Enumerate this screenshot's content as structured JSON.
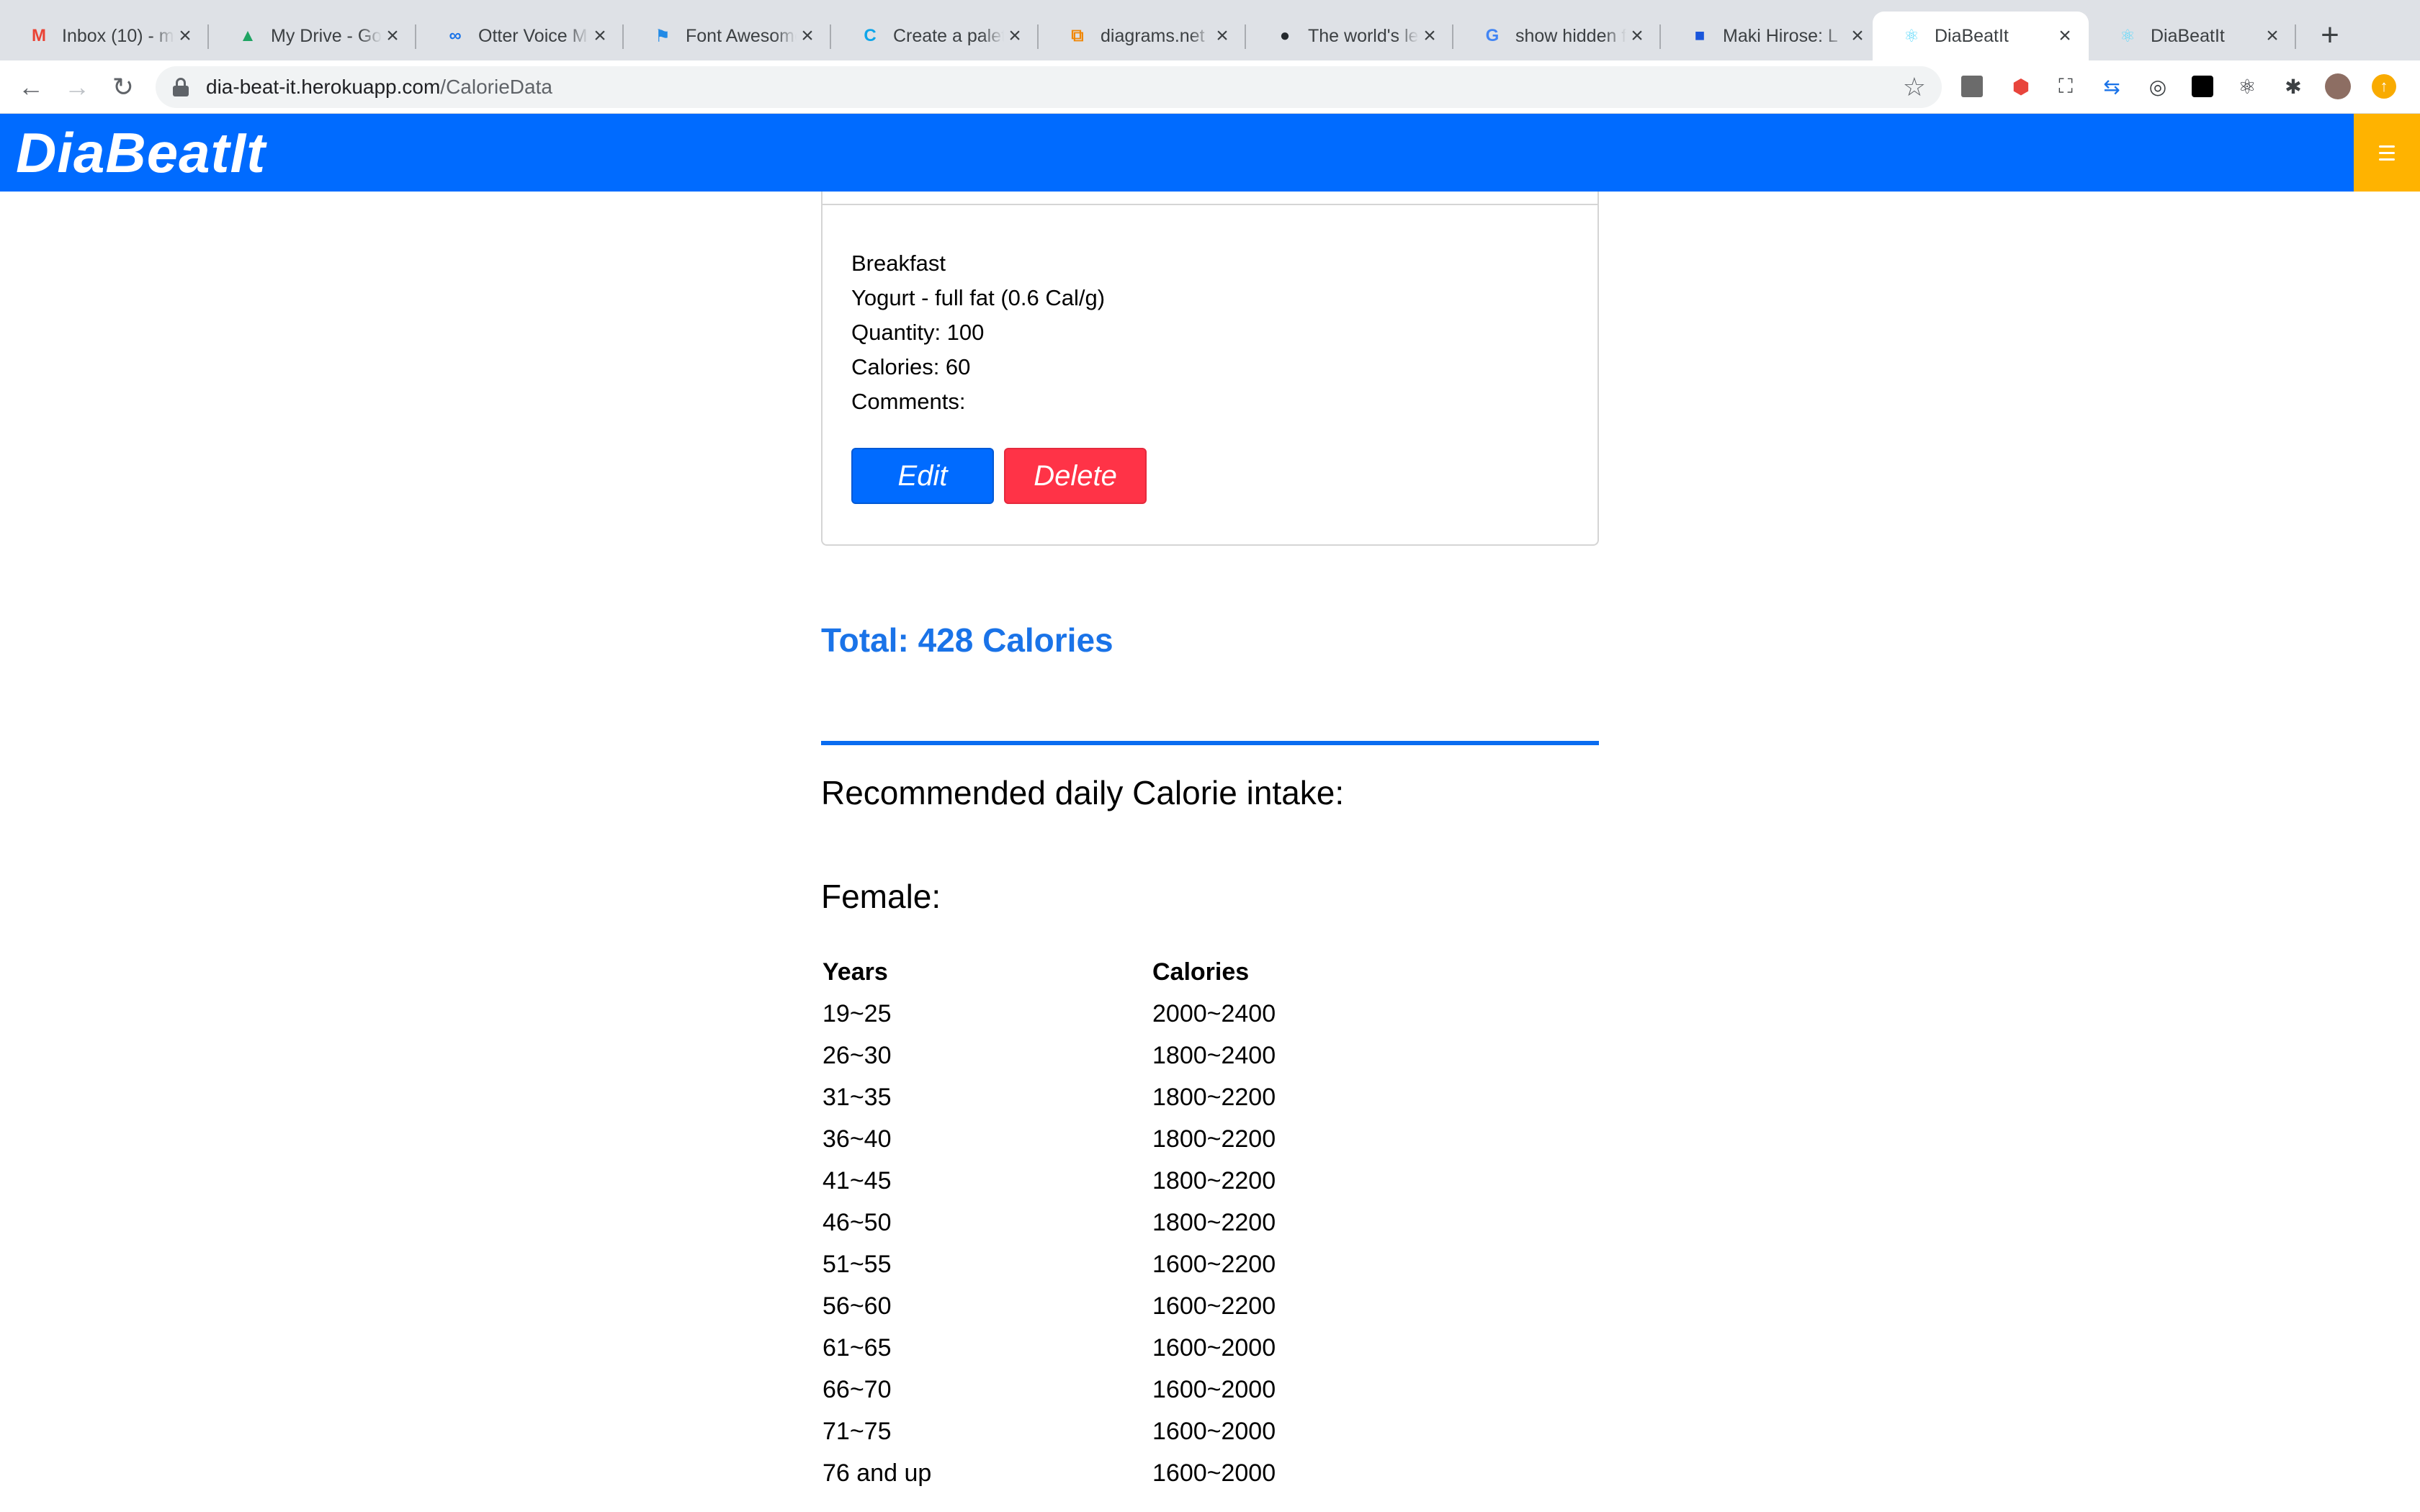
{
  "browser": {
    "tabs": [
      {
        "title": "Inbox (10) - m",
        "icon": "gmail-icon",
        "glyph": "M",
        "color": "#ea4335"
      },
      {
        "title": "My Drive - Go",
        "icon": "drive-icon",
        "glyph": "▲",
        "color": "#1fa463"
      },
      {
        "title": "Otter Voice M",
        "icon": "otter-icon",
        "glyph": "∞",
        "color": "#1a73e8"
      },
      {
        "title": "Font Awesome",
        "icon": "flag-icon",
        "glyph": "⚑",
        "color": "#228ae6"
      },
      {
        "title": "Create a palet",
        "icon": "coolors-icon",
        "glyph": "C",
        "color": "#0ea5e9"
      },
      {
        "title": "diagrams.net",
        "icon": "diagrams-icon",
        "glyph": "⧉",
        "color": "#f08705"
      },
      {
        "title": "The world's le",
        "icon": "github-icon",
        "glyph": "●",
        "color": "#24292e"
      },
      {
        "title": "show hidden f",
        "icon": "google-icon",
        "glyph": "G",
        "color": "#4285f4"
      },
      {
        "title": "Maki Hirose: L",
        "icon": "app-icon",
        "glyph": "■",
        "color": "#1a56db"
      },
      {
        "title": "DiaBeatIt",
        "icon": "react-icon",
        "glyph": "⚛",
        "color": "#61dafb",
        "active": true
      },
      {
        "title": "DiaBeatIt",
        "icon": "react-icon",
        "glyph": "⚛",
        "color": "#61dafb"
      }
    ],
    "url_host": "dia-beat-it.herokuapp.com",
    "url_path": "/CalorieData"
  },
  "app": {
    "brand": "DiaBeatIt",
    "colors": {
      "primary": "#006bff",
      "accent": "#ffb300",
      "danger": "#ff3347"
    }
  },
  "entry": {
    "meal": "Breakfast",
    "food": "Yogurt - full fat (0.6 Cal/g)",
    "quantity": "Quantity: 100",
    "calories": "Calories: 60",
    "comments": "Comments:",
    "edit_label": "Edit",
    "delete_label": "Delete"
  },
  "total": "Total: 428 Calories",
  "recommend": {
    "heading": "Recommended daily Calorie intake:",
    "subheading": "Female:",
    "columns": [
      "Years",
      "Calories"
    ],
    "rows": [
      [
        "19~25",
        "2000~2400"
      ],
      [
        "26~30",
        "1800~2400"
      ],
      [
        "31~35",
        "1800~2200"
      ],
      [
        "36~40",
        "1800~2200"
      ],
      [
        "41~45",
        "1800~2200"
      ],
      [
        "46~50",
        "1800~2200"
      ],
      [
        "51~55",
        "1600~2200"
      ],
      [
        "56~60",
        "1600~2200"
      ],
      [
        "61~65",
        "1600~2000"
      ],
      [
        "66~70",
        "1600~2000"
      ],
      [
        "71~75",
        "1600~2000"
      ],
      [
        "76 and up",
        "1600~2000"
      ]
    ]
  }
}
